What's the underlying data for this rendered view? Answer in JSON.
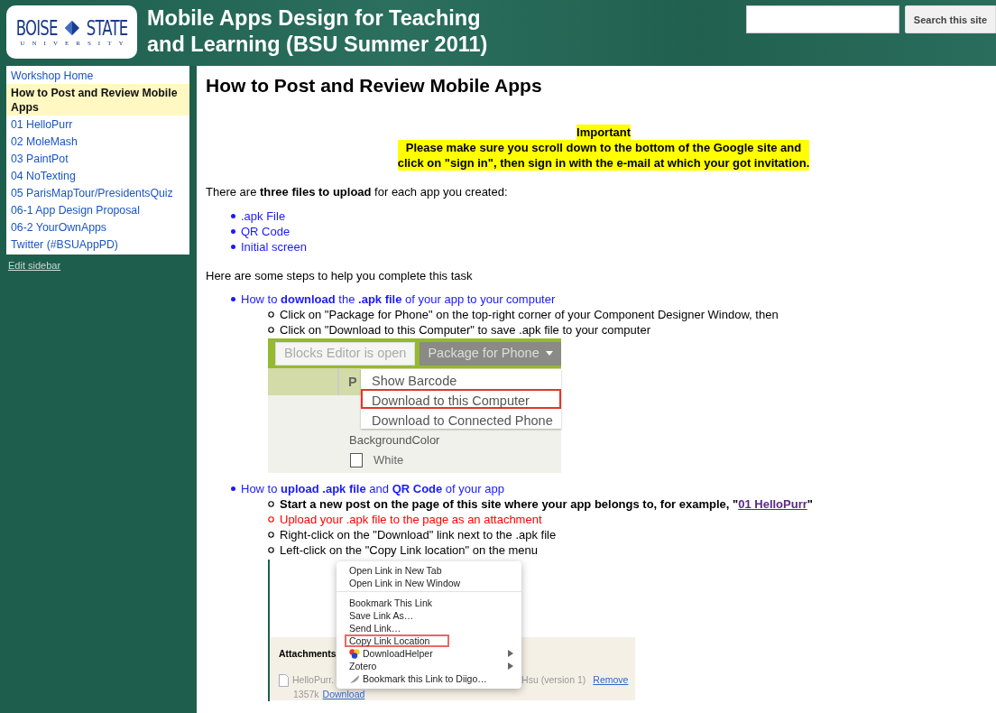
{
  "header": {
    "logo": {
      "left": "BOISE",
      "right": "STATE",
      "sub": "UNIVERSITY"
    },
    "title_lines": [
      "Mobile Apps Design for Teaching",
      "and Learning (BSU Summer 2011)"
    ],
    "search": {
      "button": "Search this site"
    }
  },
  "sidebar": {
    "items": [
      {
        "label": "Workshop Home",
        "selected": false
      },
      {
        "label": "How to Post and Review Mobile Apps",
        "selected": true
      },
      {
        "label": "01 HelloPurr",
        "selected": false
      },
      {
        "label": "02 MoleMash",
        "selected": false
      },
      {
        "label": "03 PaintPot",
        "selected": false
      },
      {
        "label": "04 NoTexting",
        "selected": false
      },
      {
        "label": "05 ParisMapTour/PresidentsQuiz",
        "selected": false
      },
      {
        "label": "06-1 App Design Proposal",
        "selected": false
      },
      {
        "label": "06-2 YourOwnApps",
        "selected": false
      },
      {
        "label": "Twitter (#BSUAppPD)",
        "selected": false
      }
    ],
    "edit_link": "Edit sidebar"
  },
  "content": {
    "heading": "How to Post and Review Mobile Apps",
    "notice": {
      "title": "Important",
      "lines": [
        "Please make sure you scroll down to the bottom of the Google site and",
        "click on \"sign in\", then sign in with the e-mail at which your got invitation."
      ]
    },
    "intro": "There are **three files to upload** for each app you created:",
    "files": [
      ".apk File",
      "QR Code",
      "Initial screen"
    ],
    "steps_intro": "Here are some steps to help you complete this task",
    "steps": [
      {
        "title": "How to **download** the **.apk file** of your app to your computer",
        "substeps": [
          {
            "kind": "plain",
            "text": "Click on \"Package for Phone\" on the top-right corner of your Component Designer Window, then"
          },
          {
            "kind": "plain",
            "text": "Click on \"Download to this Computer\" to save .apk file to your computer"
          }
        ],
        "figure": {
          "kind": "designer",
          "buttons": [
            {
              "label": "Blocks Editor is open",
              "disabled": true
            },
            {
              "label": "Package for Phone",
              "disabled": false
            }
          ],
          "column_header": "P",
          "menu": [
            {
              "label": "Show Barcode",
              "highlighted": false
            },
            {
              "label": "Download to this Computer",
              "highlighted": true
            },
            {
              "label": "Download to Connected Phone",
              "highlighted": false
            }
          ],
          "property": "BackgroundColor",
          "color_option": {
            "label": "White",
            "checked": false
          }
        }
      },
      {
        "title": "How to **upload .apk file** and **QR Code** of your app",
        "substeps": [
          {
            "kind": "bold",
            "text": "Start a new post on the page of this site where your app belongs to, for example, \"",
            "link": "01 HelloPurr",
            "after": "\""
          },
          {
            "kind": "red",
            "text": "Upload your .apk file to the page as an attachment"
          },
          {
            "kind": "plain",
            "text": "Right-click on the \"Download\" link next to the .apk file"
          },
          {
            "kind": "plain",
            "text": "Left-click on the \"Copy Link location\" on the menu"
          }
        ],
        "figure": {
          "kind": "context_menu",
          "attachments_label": "Attachments",
          "file_name": "HelloPurr.",
          "file_meta": "Hsu (version 1)",
          "remove_link": "Remove",
          "file_size": "1357k",
          "download_link": "Download",
          "menu_groups": [
            [
              {
                "kind": "plain",
                "label": "Open Link in New Tab",
                "highlighted": false,
                "submenu": false
              },
              {
                "kind": "plain",
                "label": "Open Link in New Window",
                "highlighted": false,
                "submenu": false
              }
            ],
            [
              {
                "kind": "plain",
                "label": "Bookmark This Link",
                "highlighted": false,
                "submenu": false
              },
              {
                "kind": "plain",
                "label": "Save Link As…",
                "highlighted": false,
                "submenu": false
              },
              {
                "kind": "plain",
                "label": "Send Link…",
                "highlighted": false,
                "submenu": false
              },
              {
                "kind": "plain",
                "label": "Copy Link Location",
                "highlighted": true,
                "submenu": false
              },
              {
                "kind": "addon",
                "label": "DownloadHelper",
                "highlighted": false,
                "submenu": true
              },
              {
                "kind": "plain",
                "label": "Zotero",
                "highlighted": false,
                "submenu": true
              },
              {
                "kind": "bookmark",
                "label": "Bookmark this Link to Diigo…",
                "highlighted": false,
                "submenu": false
              }
            ]
          ]
        }
      }
    ]
  }
}
